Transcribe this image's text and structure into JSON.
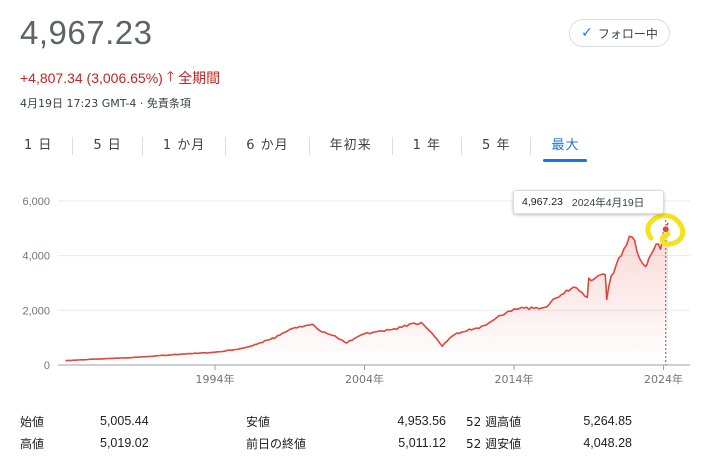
{
  "quote": {
    "price": "4,967.23",
    "change": "+4,807.34 (3,006.65%)",
    "change_arrow": "🡑",
    "period": "全期間",
    "timestamp": "4月19日 17:23 GMT-4 · 免責条項",
    "follow_label": "フォロー中",
    "follow_icon": "check-icon",
    "change_color": "#c5221f"
  },
  "tabs": [
    {
      "label": "1 日"
    },
    {
      "label": "5 日"
    },
    {
      "label": "1 か月"
    },
    {
      "label": "6 か月"
    },
    {
      "label": "年初来"
    },
    {
      "label": "1 年"
    },
    {
      "label": "5 年"
    },
    {
      "label": "最大",
      "active": true
    }
  ],
  "tooltip": {
    "value": "4,967.23",
    "date": "2024年4月19日"
  },
  "chart_data": {
    "type": "area",
    "line_color": "#e0453a",
    "y_ticks": [
      "6,000",
      "4,000",
      "2,000",
      "0"
    ],
    "y_tick_values": [
      6000,
      4000,
      2000,
      0
    ],
    "x_ticks": [
      "1994年",
      "2004年",
      "2014年",
      "2024年"
    ],
    "x_tick_values": [
      1994,
      2004,
      2014,
      2024
    ],
    "xlim": [
      1983.5,
      2024.3
    ],
    "ylim": [
      0,
      6000
    ],
    "grid": true,
    "x": [
      1984,
      1986,
      1988,
      1990,
      1992,
      1994,
      1996,
      1998,
      1999,
      2000,
      2000.5,
      2001,
      2002,
      2002.8,
      2003,
      2004,
      2005,
      2006,
      2007,
      2007.8,
      2008.5,
      2009.2,
      2010,
      2011,
      2012,
      2013,
      2014,
      2015,
      2016,
      2017,
      2018,
      2018.9,
      2019,
      2020.1,
      2020.2,
      2020.5,
      2021,
      2021.9,
      2022.4,
      2022.8,
      2023,
      2023.5,
      2023.8,
      2024.0,
      2024.3
    ],
    "y": [
      160,
      215,
      260,
      330,
      410,
      460,
      620,
      1000,
      1300,
      1450,
      1500,
      1250,
      1050,
      800,
      880,
      1150,
      1220,
      1310,
      1480,
      1520,
      1200,
      700,
      1120,
      1280,
      1420,
      1800,
      2050,
      2080,
      2100,
      2550,
      2850,
      2500,
      3100,
      3380,
      2450,
      3200,
      3900,
      4780,
      3900,
      3600,
      3900,
      4450,
      4200,
      4800,
      5200
    ],
    "current_value": 4967.23
  },
  "stats": [
    [
      {
        "label": "始値",
        "value": "5,005.44"
      },
      {
        "label": "安値",
        "value": "4,953.56"
      },
      {
        "label": "52 週高値",
        "value": "5,264.85"
      }
    ],
    [
      {
        "label": "高値",
        "value": "5,019.02"
      },
      {
        "label": "前日の終値",
        "value": "5,011.12"
      },
      {
        "label": "52 週安値",
        "value": "4,048.28"
      }
    ]
  ]
}
